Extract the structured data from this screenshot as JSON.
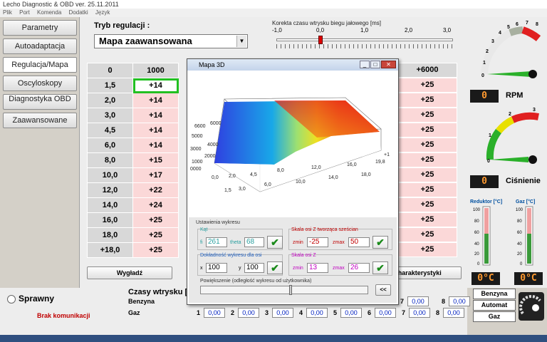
{
  "window": {
    "title": "Lecho Diagnostic & OBD ver.  25.11.2011"
  },
  "menu": [
    "Plik",
    "Port",
    "Komenda",
    "Dodatki",
    "Język"
  ],
  "sidebar": {
    "items": [
      "Parametry",
      "Autoadaptacja",
      "Regulacja/Mapa",
      "Oscyloskopy",
      "Diagnostyka OBD",
      "Zaawansowane"
    ]
  },
  "mode": {
    "label": "Tryb regulacji :",
    "selected": "Mapa zaawansowana"
  },
  "correction": {
    "label": "Korekta czasu wtrysku biegu jałowego [ms]",
    "ticks": [
      "-1,0",
      "0,0",
      "1,0",
      "2,0",
      "3,0"
    ],
    "value": 0.0
  },
  "table": {
    "col_headers": [
      "0",
      "1000",
      "+6000"
    ],
    "rows": [
      "1,5",
      "2,0",
      "3,0",
      "4,5",
      "6,0",
      "8,0",
      "10,0",
      "12,0",
      "14,0",
      "16,0",
      "18,0",
      "+18,0"
    ],
    "col1000": [
      "+14",
      "+14",
      "+14",
      "+14",
      "+14",
      "+15",
      "+17",
      "+22",
      "+24",
      "+25",
      "+25",
      "+25"
    ],
    "col6000": [
      "+25",
      "+25",
      "+25",
      "+25",
      "+25",
      "+25",
      "+25",
      "+25",
      "+25",
      "+25",
      "+25",
      "+25"
    ]
  },
  "buttons": {
    "smooth": "Wygładź",
    "characteristics": "Charakterystyki"
  },
  "gauges": {
    "rpm": {
      "label": "RPM",
      "value": "0",
      "ticks": [
        "0",
        "1",
        "2",
        "3",
        "4",
        "5",
        "6",
        "7",
        "8"
      ]
    },
    "pressure": {
      "label": "Ciśnienie",
      "value": "0",
      "ticks": [
        "0",
        "1",
        "2",
        "3"
      ]
    },
    "reducer": {
      "label": "Reduktor [°C]",
      "value": "0°C",
      "scale": [
        "100",
        "80",
        "60",
        "40",
        "20",
        "0"
      ]
    },
    "gas": {
      "label": "Gaz [°C]",
      "value": "0°C",
      "scale": [
        "100",
        "80",
        "60",
        "40",
        "20",
        "0"
      ]
    }
  },
  "status": {
    "ok_label": "Sprawny",
    "comm": "Brak komunikacji"
  },
  "injection": {
    "title": "Czasy wtrysku [ms]",
    "benzyna_label": "Benzyna",
    "gaz_label": "Gaz",
    "benzyna": [
      "0,00",
      "0,00"
    ],
    "gaz": [
      "0,00",
      "0,00",
      "0,00",
      "0,00",
      "0,00",
      "0,00",
      "0,00",
      "0,00"
    ],
    "indices": [
      "1",
      "2",
      "3",
      "4",
      "5",
      "6",
      "7",
      "8"
    ]
  },
  "fuel_buttons": [
    "Benzyna",
    "Automat",
    "Gaz"
  ],
  "dialog": {
    "title": "Mapa 3D",
    "settings_title": "Ustawienia wykresu",
    "angles": {
      "title": "Kąt",
      "fi_label": "fi",
      "fi": "261",
      "theta_label": "theta",
      "theta": "68"
    },
    "zscale": {
      "title": "Skala osi Z tworząca sześcian",
      "zmin_label": "zmin",
      "zmin": "-25",
      "zmax_label": "zmax",
      "zmax": "50"
    },
    "precision": {
      "title": "Dokładność wykresu dla osi",
      "x_label": "x",
      "x": "100",
      "y_label": "y",
      "y": "100"
    },
    "zaxis": {
      "title": "Skala osi Z",
      "zmin_label": "zmin",
      "zmin": "13",
      "zmax_label": "zmax",
      "zmax": "26"
    },
    "zoom": {
      "title": "Powiększenie (odległość wykresu od użytkownika)",
      "button": "<<"
    },
    "axis_left": [
      "6600",
      "6000",
      "5000",
      "4000",
      "3000",
      "2000",
      "1000",
      "0000"
    ],
    "axis_bottom_front": [
      "0,0",
      "1,5",
      "2,0",
      "3,0",
      "4,5",
      "6,0",
      "8,0",
      "10,0",
      "12,0",
      "14,0",
      "16,0",
      "18,0",
      "19,8"
    ],
    "axis_right": [
      "+1"
    ]
  },
  "colors": {
    "table_pink": "#fbd8d8",
    "selected_cell": "#22c022",
    "digit_fg": "#ff9a30"
  }
}
